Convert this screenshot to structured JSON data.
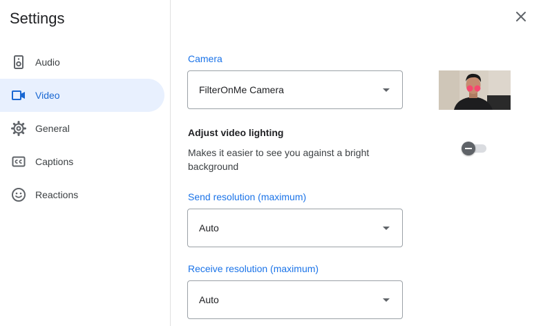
{
  "title": "Settings",
  "sidebar": {
    "items": [
      {
        "label": "Audio",
        "icon": "speaker-icon"
      },
      {
        "label": "Video",
        "icon": "video-camera-icon",
        "active": true
      },
      {
        "label": "General",
        "icon": "gear-icon"
      },
      {
        "label": "Captions",
        "icon": "closed-captions-icon"
      },
      {
        "label": "Reactions",
        "icon": "smiley-icon"
      }
    ]
  },
  "video": {
    "camera_label": "Camera",
    "camera_value": "FilterOnMe Camera",
    "lighting_heading": "Adjust video lighting",
    "lighting_description": "Makes it easier to see you against a bright background",
    "lighting_enabled": false,
    "send_label": "Send resolution (maximum)",
    "send_value": "Auto",
    "receive_label": "Receive resolution (maximum)",
    "receive_value": "Auto"
  },
  "colors": {
    "accent": "#1a73e8",
    "active_bg": "#e8f0fe",
    "active_text": "#1967d2"
  }
}
